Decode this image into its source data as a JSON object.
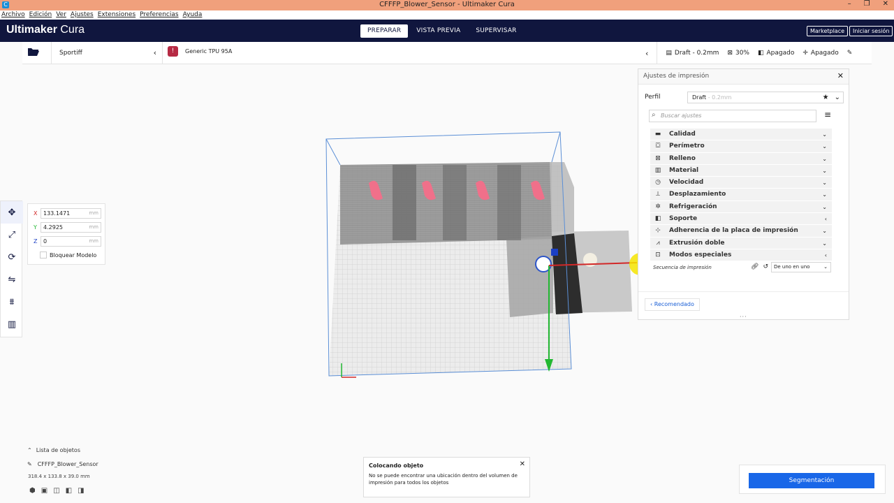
{
  "window": {
    "title": "CFFFP_Blower_Sensor - Ultimaker Cura",
    "app_icon": "C"
  },
  "menu": [
    "Archivo",
    "Edición",
    "Ver",
    "Ajustes",
    "Extensiones",
    "Preferencias",
    "Ayuda"
  ],
  "header": {
    "brand_bold": "Ultimaker",
    "brand_light": " Cura",
    "stages": [
      "PREPARAR",
      "VISTA PREVIA",
      "SUPERVISAR"
    ],
    "marketplace": "Marketplace",
    "signin": "Iniciar sesión"
  },
  "toolbar": {
    "printer": "Sportiff",
    "material": "Generic TPU 95A",
    "profile": "Draft - 0.2mm",
    "infill": "30%",
    "support": "Apagado",
    "adhesion": "Apagado"
  },
  "move": {
    "x": "133.1471",
    "y": "4.2925",
    "z": "0",
    "unit": "mm",
    "x_label": "X",
    "y_label": "Y",
    "z_label": "Z",
    "lock": "Bloquear Modelo"
  },
  "settings": {
    "title": "Ajustes de impresión",
    "profile_label": "Perfil",
    "profile_value": "Draft",
    "profile_sub": " - 0.2mm",
    "search_placeholder": "Buscar ajustes",
    "categories": [
      {
        "label": "Calidad",
        "icon": "quality-icon",
        "glyph": "▬",
        "arrow": "⌄"
      },
      {
        "label": "Perímetro",
        "icon": "shell-icon",
        "glyph": "⛋",
        "arrow": "⌄"
      },
      {
        "label": "Relleno",
        "icon": "infill-icon",
        "glyph": "⊠",
        "arrow": "⌄"
      },
      {
        "label": "Material",
        "icon": "material-icon",
        "glyph": "▥",
        "arrow": "⌄"
      },
      {
        "label": "Velocidad",
        "icon": "speed-icon",
        "glyph": "◷",
        "arrow": "⌄"
      },
      {
        "label": "Desplazamiento",
        "icon": "travel-icon",
        "glyph": "⟂",
        "arrow": "⌄"
      },
      {
        "label": "Refrigeración",
        "icon": "cooling-icon",
        "glyph": "✲",
        "arrow": "⌄"
      },
      {
        "label": "Soporte",
        "icon": "support-icon",
        "glyph": "◧",
        "arrow": "‹"
      },
      {
        "label": "Adherencia de la placa de impresión",
        "icon": "adhesion-icon",
        "glyph": "⊹",
        "arrow": "⌄"
      },
      {
        "label": "Extrusión doble",
        "icon": "dual-icon",
        "glyph": "⩘",
        "arrow": "⌄"
      },
      {
        "label": "Modos especiales",
        "icon": "blackmagic-icon",
        "glyph": "⊡",
        "arrow": "‹"
      }
    ],
    "sequence_label": "Secuencia de impresión",
    "sequence_value": "De uno en uno",
    "recommended": "Recomendado"
  },
  "objects": {
    "header": "Lista de objetos",
    "name": "CFFFP_Blower_Sensor",
    "dims": "318.4 x 133.8 x 39.0 mm"
  },
  "message": {
    "title": "Colocando objeto",
    "text": "No se puede encontrar una ubicación dentro del volumen de impresión para todos los objetos"
  },
  "slice": {
    "label": "Segmentación"
  },
  "colors": {
    "header_bg": "#10163e",
    "accent": "#1967e8",
    "titlebar": "#f0a07c"
  }
}
